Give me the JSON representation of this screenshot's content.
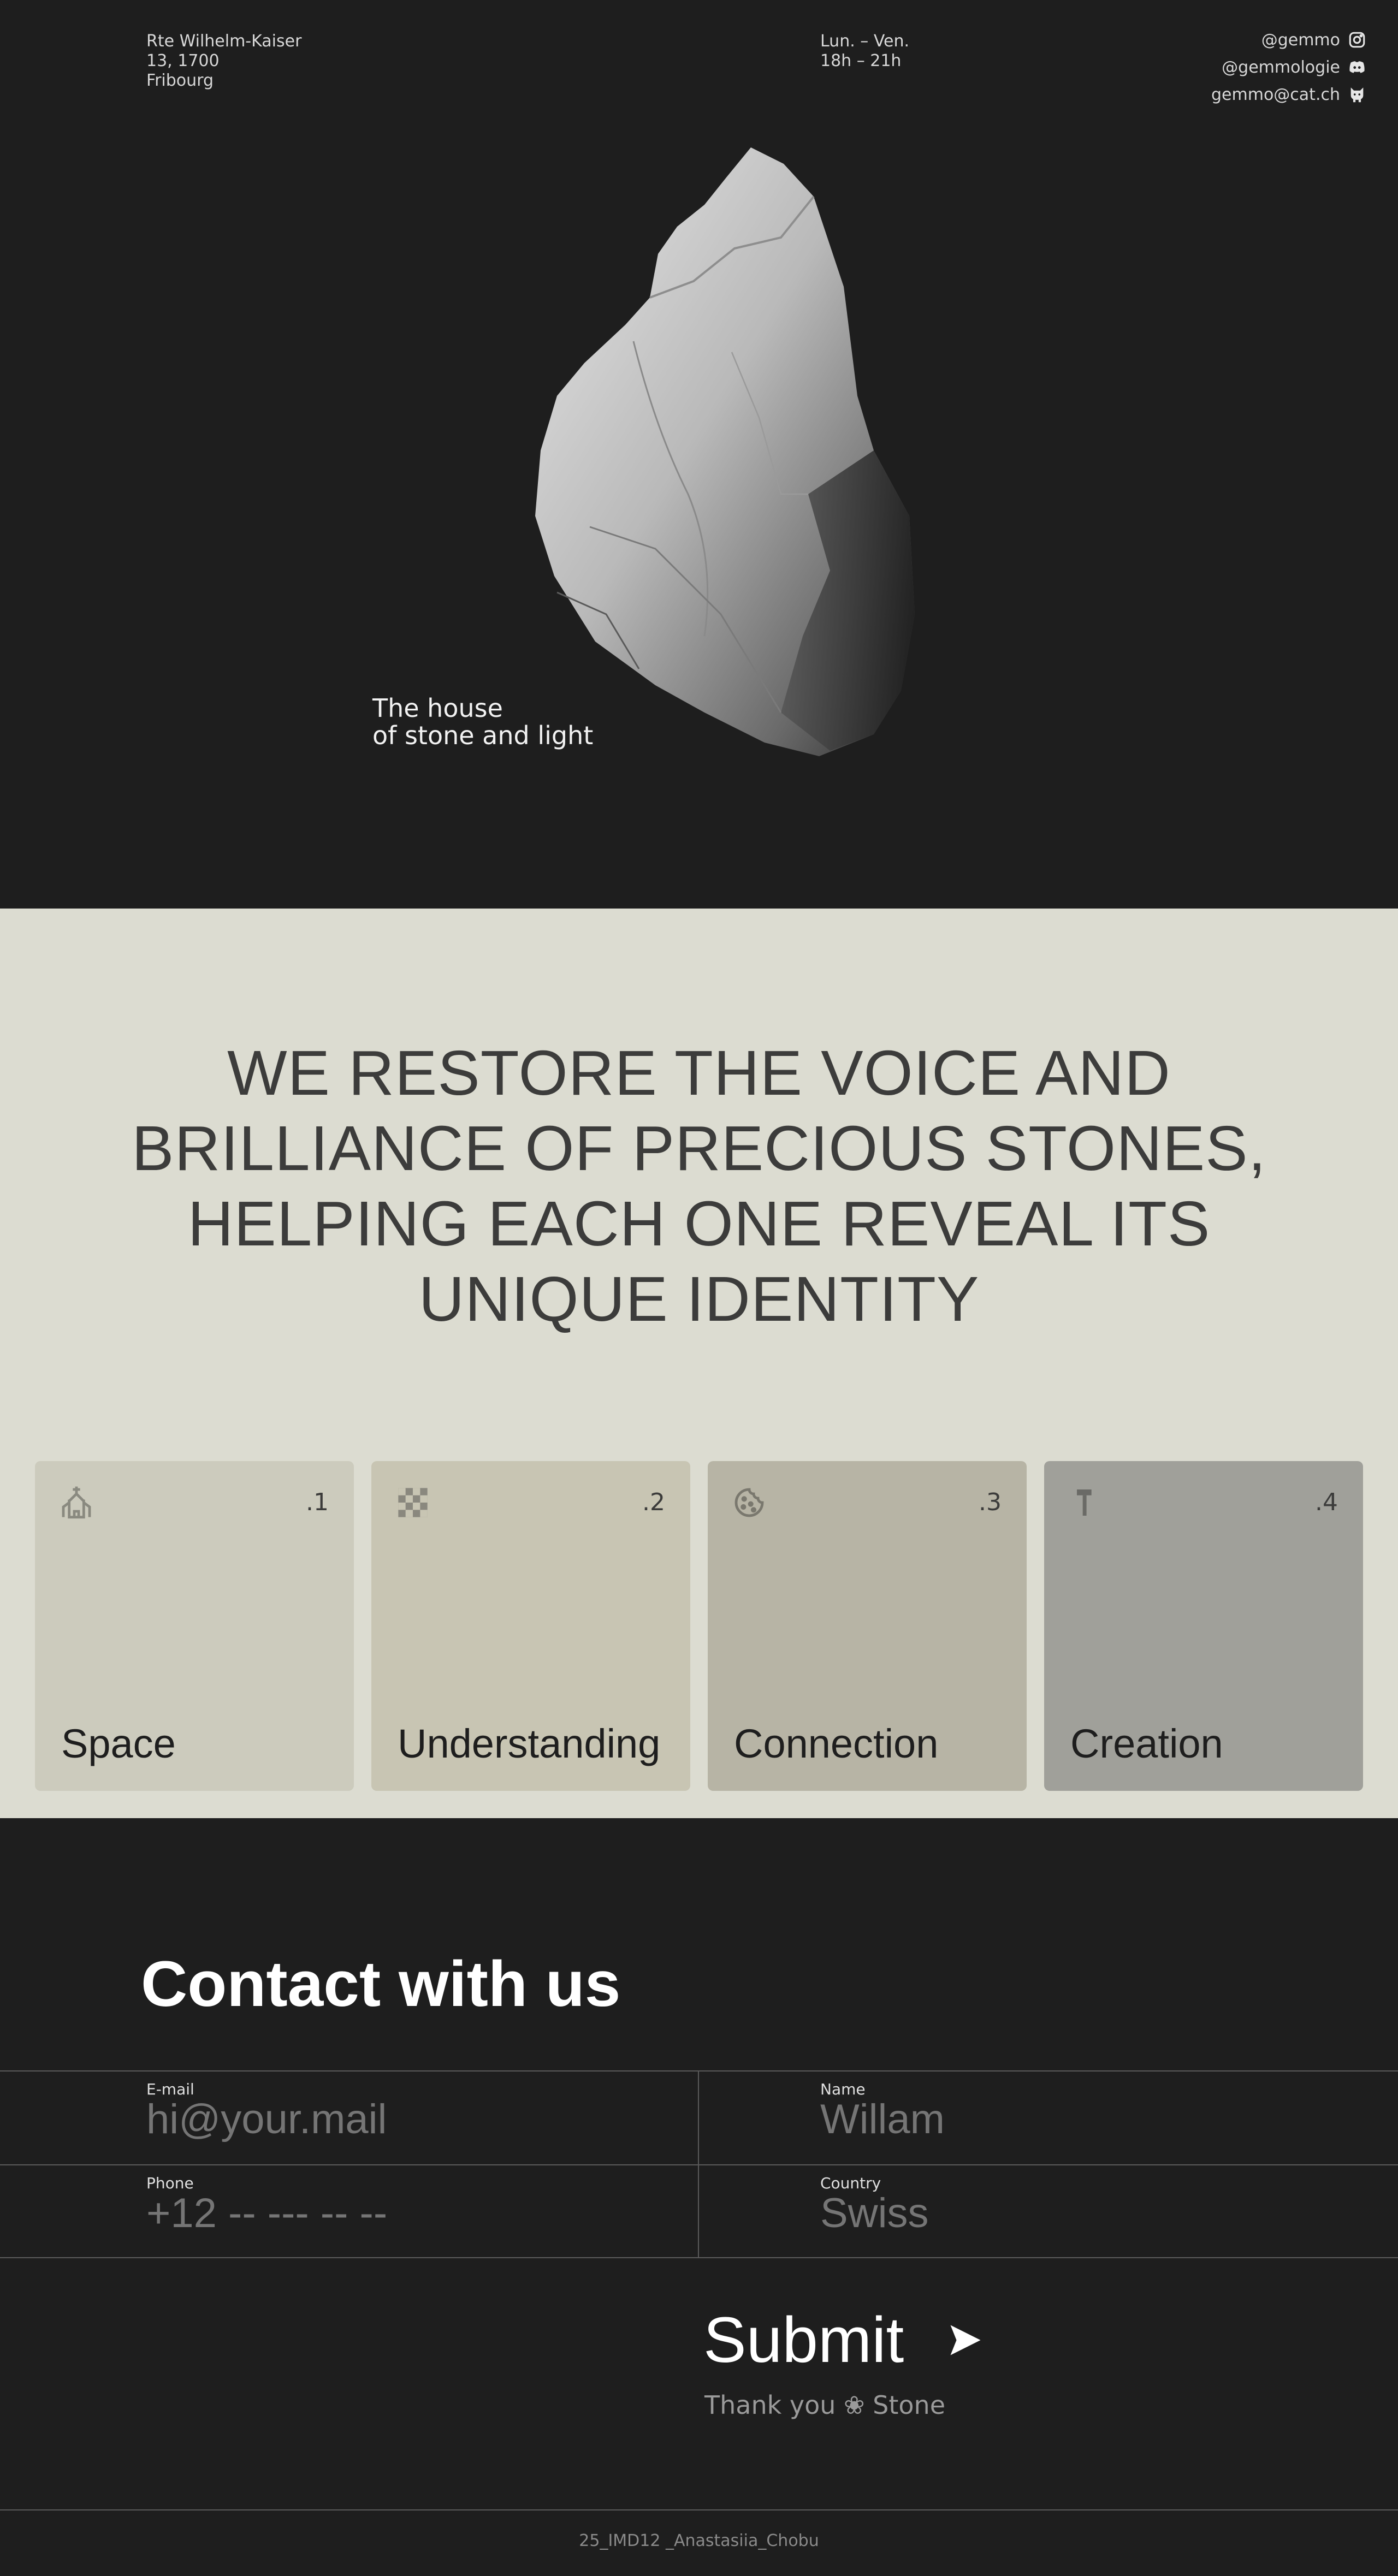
{
  "header": {
    "address": [
      "Rte Wilhelm-Kaiser",
      "13, 1700",
      "Fribourg"
    ],
    "hours": [
      "Lun. – Ven.",
      "18h  – 21h"
    ],
    "social": [
      {
        "text": "@gemmo",
        "icon": "instagram-icon"
      },
      {
        "text": "@gemmologie",
        "icon": "discord-icon"
      },
      {
        "text": "gemmo@cat.ch",
        "icon": "cat-icon"
      }
    ]
  },
  "hero": {
    "tagline": [
      "The house",
      "of stone and light"
    ]
  },
  "mission": {
    "text": "WE RESTORE THE VOICE AND BRILLIANCE OF PRECIOUS STONES, HELPING EACH ONE REVEAL ITS UNIQUE IDENTITY"
  },
  "cards": [
    {
      "num": ".1",
      "label": "Space",
      "icon": "church-icon",
      "color": "#cccbbd"
    },
    {
      "num": ".2",
      "label": "Understanding",
      "icon": "checker-icon",
      "color": "#c8c5b3"
    },
    {
      "num": ".3",
      "label": "Connection",
      "icon": "cookie-icon",
      "color": "#b7b4a5"
    },
    {
      "num": ".4",
      "label": "Creation",
      "icon": "hammer-icon",
      "color": "#a0a09a"
    }
  ],
  "contact": {
    "title": "Contact with us",
    "fields": {
      "email": {
        "label": "E-mail",
        "placeholder": "hi@your.mail"
      },
      "name": {
        "label": "Name",
        "placeholder": "Willam"
      },
      "phone": {
        "label": "Phone",
        "placeholder": "+12 -- --- -- --"
      },
      "country": {
        "label": "Country",
        "placeholder": "Swiss"
      }
    },
    "submit": "Submit",
    "thanks": "Thank you ❀ Stone"
  },
  "footer": {
    "credit": "25_IMD12 _Anastasiia_Chobu"
  }
}
